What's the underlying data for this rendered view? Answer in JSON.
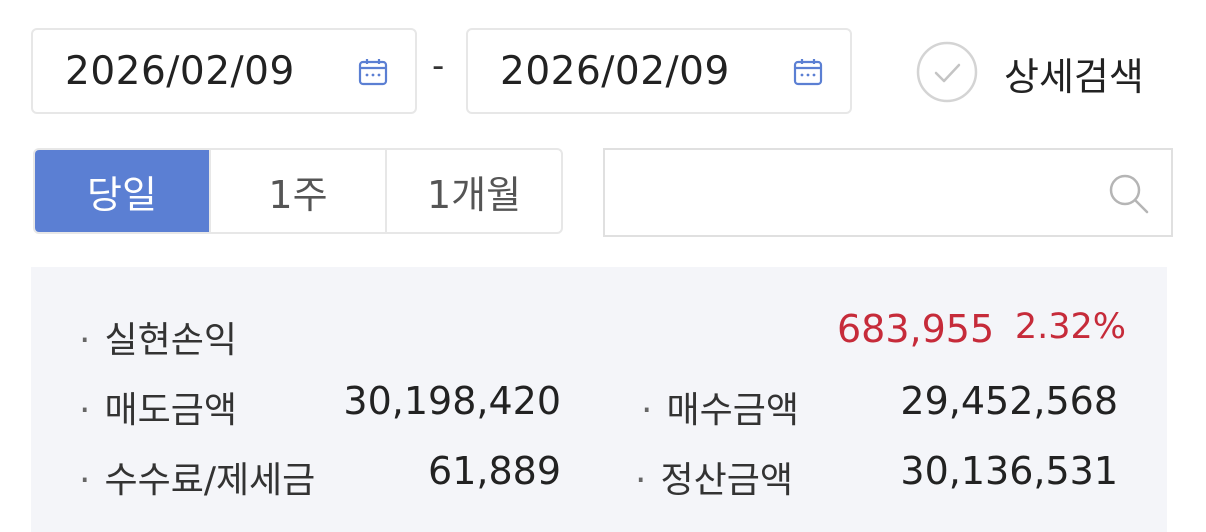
{
  "date_range": {
    "start": "2026/02/09",
    "separator": "-",
    "end": "2026/02/09"
  },
  "detail_search": {
    "label": "상세검색"
  },
  "period_buttons": [
    {
      "label": "당일",
      "active": true
    },
    {
      "label": "1주",
      "active": false
    },
    {
      "label": "1개월",
      "active": false
    }
  ],
  "search": {
    "value": "",
    "placeholder": ""
  },
  "summary": {
    "bullet": "·",
    "realized_pnl": {
      "label": "실현손익",
      "amount": "683,955",
      "rate": "2.32%"
    },
    "sell_amount": {
      "label": "매도금액",
      "value": "30,198,420"
    },
    "buy_amount": {
      "label": "매수금액",
      "value": "29,452,568"
    },
    "fee_tax": {
      "label": "수수료/제세금",
      "value": "61,889"
    },
    "settlement": {
      "label": "정산금액",
      "value": "30,136,531"
    }
  },
  "colors": {
    "accent": "#5b7fd3",
    "profit_red": "#c62b3a",
    "panel_bg": "#f4f5f9"
  },
  "icons": {
    "calendar": "calendar-icon",
    "check": "check-circle-icon",
    "search": "search-icon"
  }
}
